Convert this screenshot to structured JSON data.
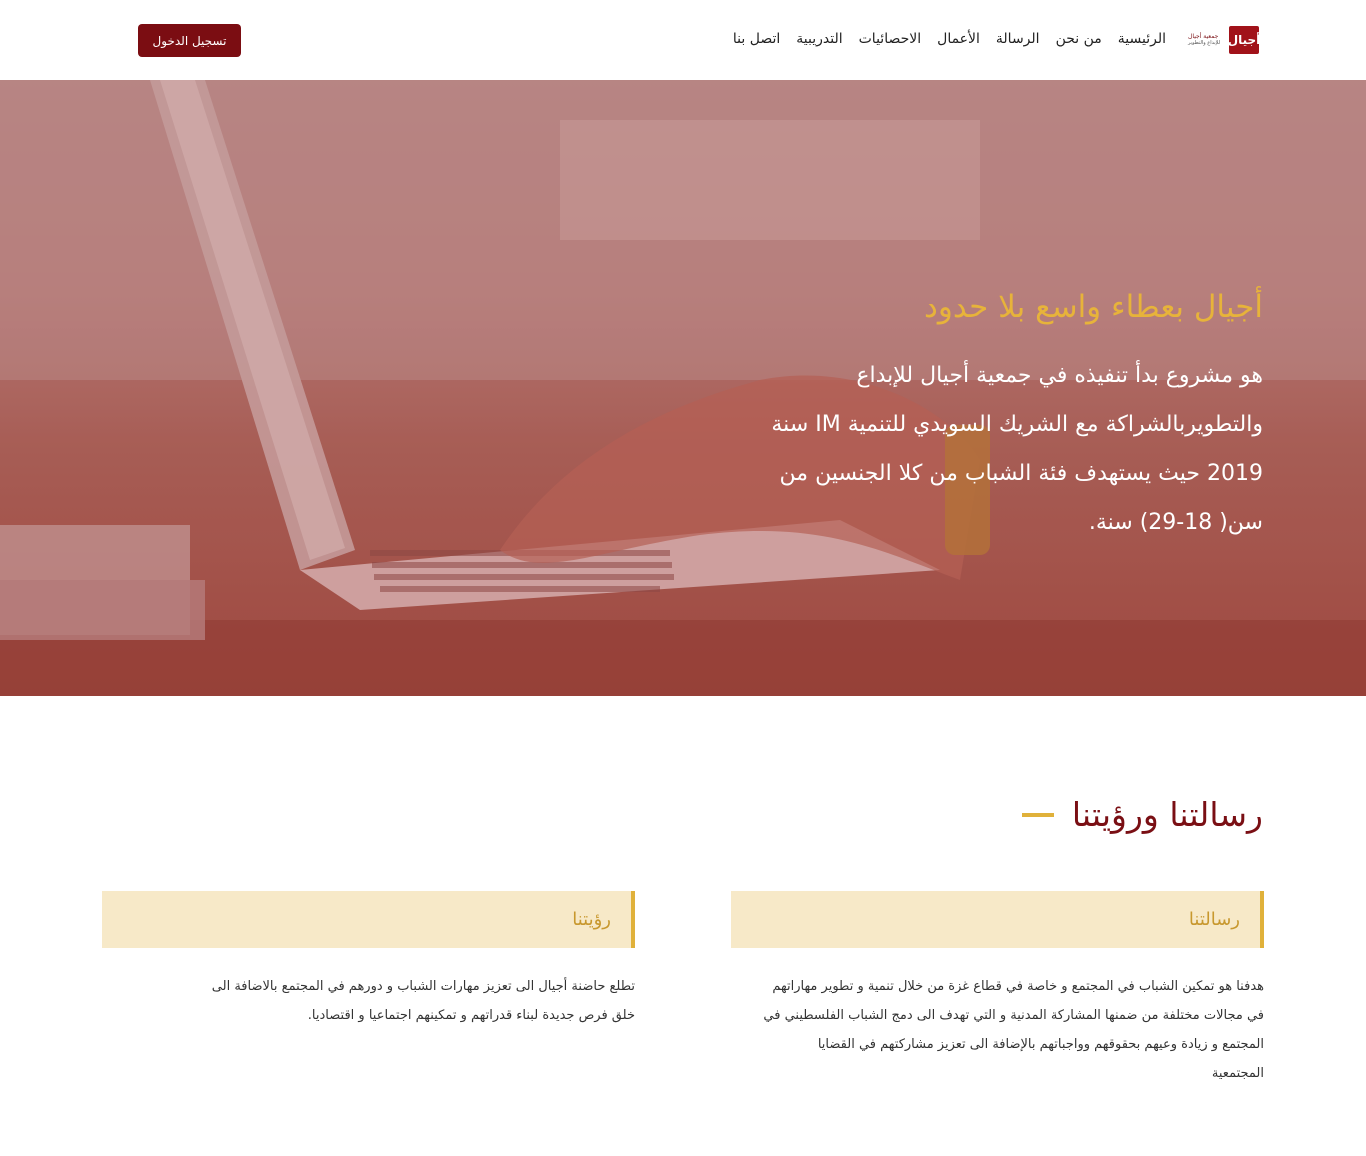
{
  "header": {
    "logo": {
      "line1": "جمعية أجيال",
      "line2": "للإبداع والتطوير",
      "mark": "أجيال"
    },
    "nav": [
      "الرئيسية",
      "من نحن",
      "الرسالة",
      "الأعمال",
      "الاحصائيات",
      "التدريبية",
      "اتصل بنا"
    ],
    "login_label": "تسجيل الدخول",
    "colors": {
      "login_bg": "#7b0d12"
    }
  },
  "hero": {
    "title": "أجيال بعطاء واسع بلا حدود",
    "lines": [
      "هو مشروع بدأ تنفيذه في جمعية أجيال للإبداع",
      "والتطويربالشراكة مع الشريك السويدي للتنمية IM سنة",
      "2019 حيث يستهدف فئة الشباب من كلا الجنسين من",
      "سن( 18-29) سنة."
    ],
    "colors": {
      "title": "#e7b33a",
      "overlay": "#a8625a"
    }
  },
  "section": {
    "title": "رسالتنا ورؤيتنا",
    "mission": {
      "heading": "رسالتنا",
      "lines": [
        "هدفنا هو تمكين الشباب في المجتمع و خاصة في قطاع غزة من خلال تنمية و تطوير مهاراتهم",
        "في مجالات مختلفة من ضمنها المشاركة المدنية و التي تهدف الى دمج الشباب الفلسطيني في",
        "المجتمع و زيادة وعيهم بحقوقهم وواجباتهم بالإضافة الى تعزيز مشاركتهم في القضايا",
        "المجتمعية"
      ]
    },
    "vision": {
      "heading": "رؤيتنا",
      "lines": [
        "تطلع حاضنة أجيال الى تعزيز مهارات الشباب و دورهم في المجتمع بالاضافة الى",
        "خلق فرص جديدة لبناء قدراتهم و تمكينهم اجتماعيا و اقتصاديا."
      ]
    },
    "colors": {
      "title": "#7a0f14",
      "accent": "#e0b13a",
      "card_bg": "#f7e9c8"
    }
  }
}
